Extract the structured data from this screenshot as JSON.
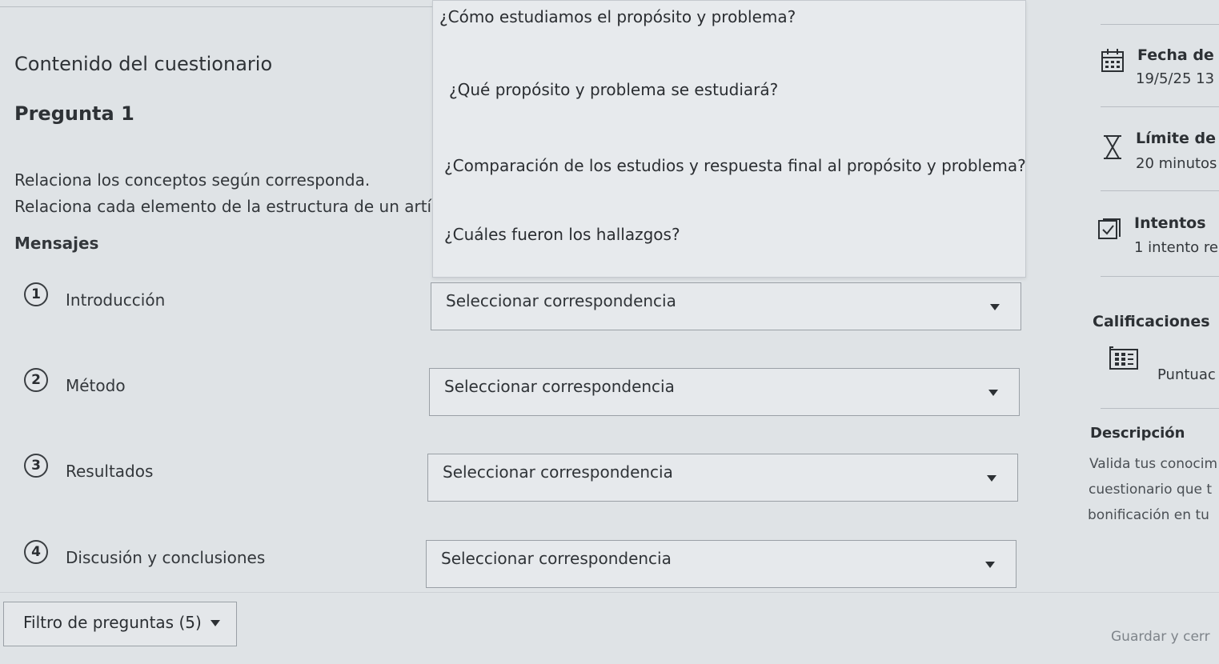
{
  "quiz": {
    "content_title": "Contenido del cuestionario",
    "question_title": "Pregunta 1",
    "instruction": "Relaciona los conceptos según corresponda.",
    "instruction_detail": "Relaciona cada elemento de la estructura de un artícu",
    "messages_label": "Mensajes"
  },
  "dropdown_options": [
    "¿Cómo estudiamos el propósito y problema?",
    "¿Qué propósito y problema se estudiará?",
    "¿Comparación de los estudios y respuesta final al propósito y problema?",
    "¿Cuáles fueron los hallazgos?"
  ],
  "items": [
    {
      "number": "1",
      "label": "Introducción",
      "select_value": "Seleccionar correspondencia"
    },
    {
      "number": "2",
      "label": "Método",
      "select_value": "Seleccionar correspondencia"
    },
    {
      "number": "3",
      "label": "Resultados",
      "select_value": "Seleccionar correspondencia"
    },
    {
      "number": "4",
      "label": "Discusión y conclusiones",
      "select_value": "Seleccionar correspondencia"
    }
  ],
  "footer": {
    "filter_label": "Filtro de preguntas (5)",
    "save_label": "Guardar y cerr"
  },
  "sidebar": {
    "date_heading": "Fecha de e",
    "date_value": "19/5/25 13",
    "limit_heading": "Límite de t",
    "limit_value": "20 minutos",
    "attempts_heading": "Intentos",
    "attempts_value": "1 intento re",
    "grades_heading": "Calificaciones",
    "score_label": "Puntuac",
    "description_heading": "Descripción",
    "description_lines": [
      "Valida tus conocim",
      "cuestionario que t",
      "bonificación en tu"
    ]
  },
  "icons": [
    "calendar-icon",
    "hourglass-icon",
    "checkbox-icon",
    "score-grid-icon",
    "caret-down-icon"
  ]
}
